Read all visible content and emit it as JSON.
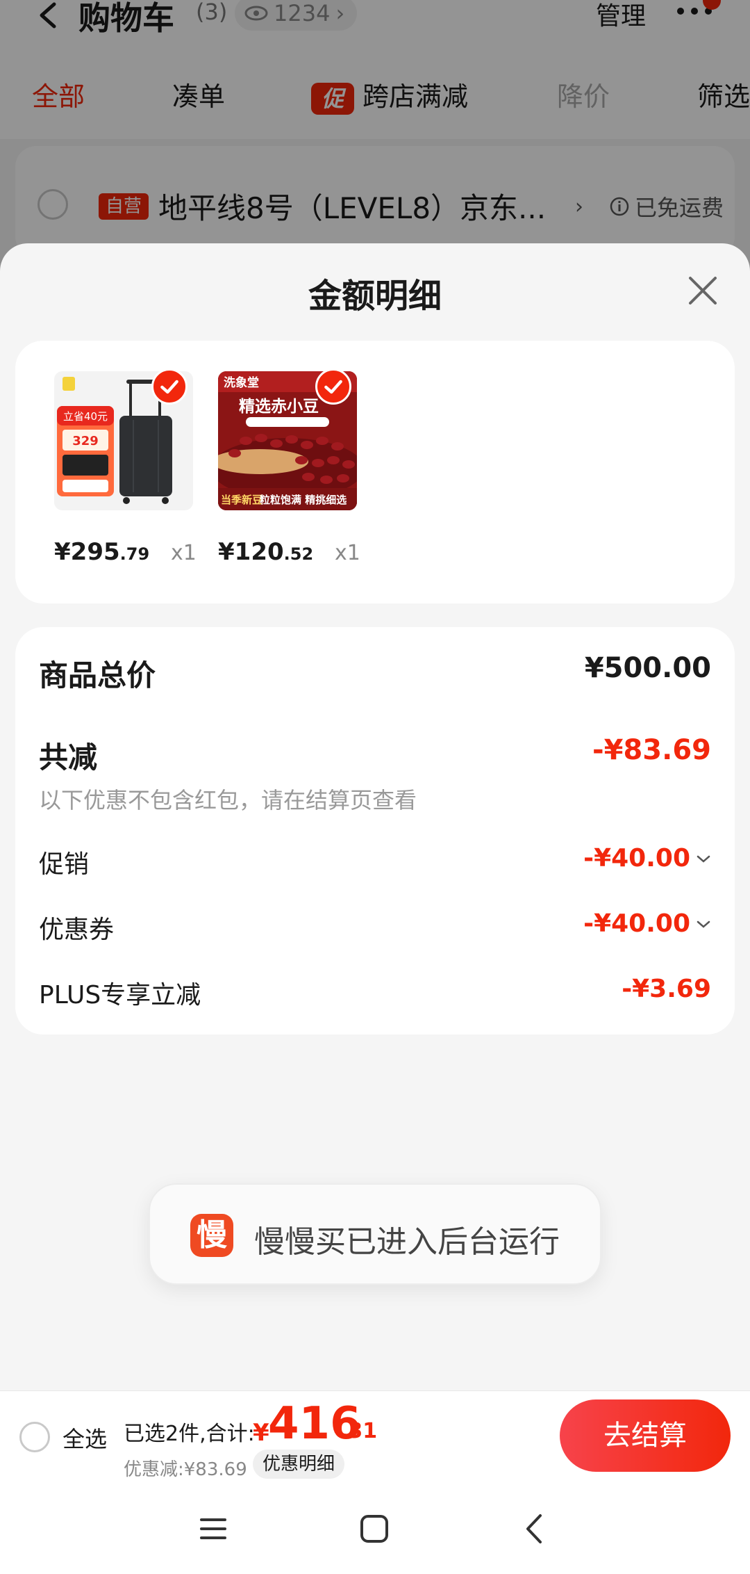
{
  "header": {
    "title": "购物车",
    "count": "(3)",
    "watch_count": "1234",
    "manage": "管理"
  },
  "filter_tabs": {
    "all": "全部",
    "bundle": "凑单",
    "promo_tag": "促",
    "cross_store": "跨店满减",
    "price_drop": "降价",
    "filter": "筛选"
  },
  "store": {
    "badge": "自营",
    "name": "地平线8号（LEVEL8）京东...",
    "shipping": "已免运费"
  },
  "sheet": {
    "title": "金额明细",
    "products": [
      {
        "price_int": "¥295",
        "price_cents": ".79",
        "qty": "x1",
        "thumb": "luggage-photo"
      },
      {
        "price_int": "¥120",
        "price_cents": ".52",
        "qty": "x1",
        "thumb": "red-beans-photo"
      }
    ],
    "product_thumb_text": {
      "luggage_promo": "立省40元",
      "luggage_price": "329",
      "beans_brand": "洗象堂",
      "beans_title": "精选赤小豆",
      "beans_tag": "当季新豆",
      "beans_slogan": "粒粒饱满 精挑细选"
    },
    "total_label": "商品总价",
    "total_value": "¥500.00",
    "reduce_label": "共减",
    "reduce_value": "-¥83.69",
    "note": "以下优惠不包含红包，请在结算页查看",
    "lines": [
      {
        "label": "促销",
        "value": "-¥40.00",
        "expandable": true
      },
      {
        "label": "优惠券",
        "value": "-¥40.00",
        "expandable": true
      },
      {
        "label": "PLUS专享立减",
        "value": "-¥3.69",
        "expandable": false
      }
    ]
  },
  "toast": {
    "icon_char": "慢",
    "text": "慢慢买已进入后台运行"
  },
  "bottom_bar": {
    "select_all": "全选",
    "selected": "已选2件,合计:",
    "total_yen": "¥",
    "total_int": "416",
    "total_cents": ".31",
    "discount": "优惠减:¥83.69",
    "discount_detail": "优惠明细",
    "checkout": "去结算"
  },
  "colors": {
    "accent": "#f2270c",
    "sheet_bg": "#f5f5f5",
    "card_bg": "#ffffff"
  }
}
